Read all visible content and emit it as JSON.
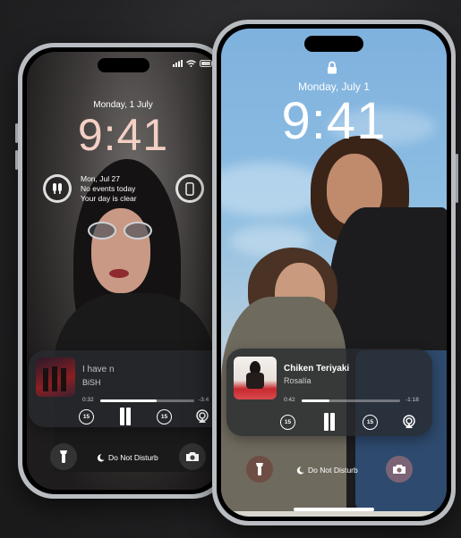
{
  "back_phone": {
    "date": "Monday, 1 July",
    "time": "9:41",
    "widget_event": {
      "date": "Mon, Jul 27",
      "line1": "No events today",
      "line2": "Your day is clear"
    },
    "music": {
      "title": "I have n",
      "artist": "BiSH",
      "elapsed": "0:32",
      "remaining": "-3:4",
      "progress": 0.6
    },
    "dnd_label": "Do Not Disturb",
    "icons": [
      "airpods-icon",
      "phone-battery-icon",
      "flashlight-icon",
      "moon-icon",
      "camera-icon",
      "wifi-icon",
      "signal-icon",
      "battery-icon"
    ]
  },
  "front_phone": {
    "date": "Monday, July 1",
    "time": "9:41",
    "music": {
      "title": "Chiken Teriyaki",
      "artist": "Rosalía",
      "elapsed": "0:42",
      "remaining": "-1:18",
      "progress": 0.28
    },
    "dnd_label": "Do Not Disturb",
    "icons": [
      "lock-icon",
      "flashlight-icon",
      "moon-icon",
      "camera-icon",
      "rewind-15-icon",
      "pause-icon",
      "forward-15-icon",
      "airplay-icon"
    ]
  },
  "skip_seconds": "15",
  "colors": {
    "back_time": "#f3cfc4",
    "front_time": "#ffffff",
    "album_back": "#8b1f22",
    "album_front": "#c72a2f"
  }
}
